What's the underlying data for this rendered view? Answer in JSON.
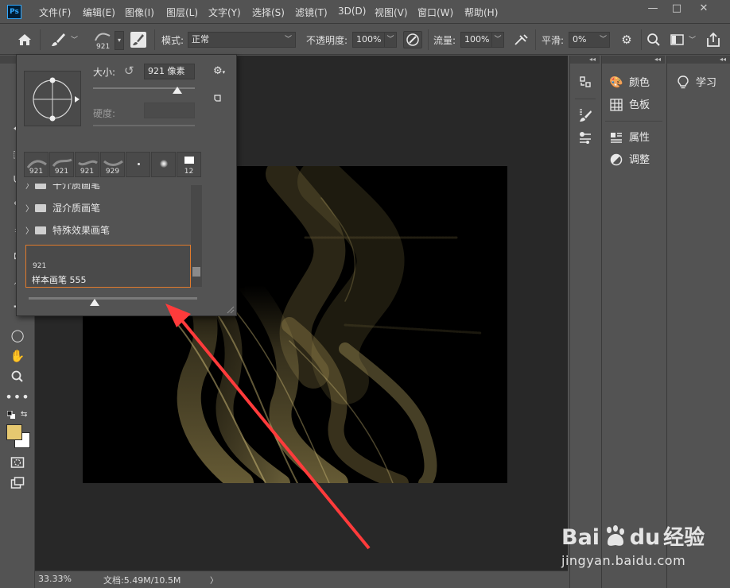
{
  "app": {
    "logo": "Ps",
    "menu": [
      "文件(F)",
      "编辑(E)",
      "图像(I)",
      "图层(L)",
      "文字(Y)",
      "选择(S)",
      "滤镜(T)",
      "3D(D)",
      "视图(V)",
      "窗口(W)",
      "帮助(H)"
    ],
    "window_controls": [
      "—",
      "□",
      "✕"
    ]
  },
  "options": {
    "brush_size": "921",
    "mode_label": "模式:",
    "mode_value": "正常",
    "opacity_label": "不透明度:",
    "opacity_value": "100%",
    "flow_label": "流量:",
    "flow_value": "100%",
    "smooth_label": "平滑:",
    "smooth_value": "0%"
  },
  "brush_panel": {
    "size_label": "大小:",
    "size_value": "921 像素",
    "size_slider_fraction": 0.83,
    "hardness_label": "硬度:",
    "hardness_value": "",
    "presets": [
      {
        "size": "921",
        "kind": "texture"
      },
      {
        "size": "921",
        "kind": "texture"
      },
      {
        "size": "921",
        "kind": "texture"
      },
      {
        "size": "929",
        "kind": "texture"
      },
      {
        "size": "",
        "kind": "small-dot"
      },
      {
        "size": "",
        "kind": "soft-dot"
      },
      {
        "size": "12",
        "kind": "square"
      }
    ],
    "folders": [
      "干介质画笔",
      "湿介质画笔",
      "特殊效果画笔"
    ],
    "selected_brush": {
      "size": "921",
      "name": "样本画笔 555"
    },
    "preview_slider_fraction": 0.39
  },
  "status": {
    "zoom": "33.33%",
    "doc_info": "文档:5.49M/10.5M",
    "arrow": "〉"
  },
  "panels": {
    "color_label": "颜色",
    "swatches_label": "色板",
    "properties_label": "属性",
    "adjustments_label": "调整",
    "learn_label": "学习",
    "collapse": "◂◂"
  },
  "colors": {
    "foreground": "#e6c870",
    "background": "#ffffff",
    "accent_selection": "#e07a2c",
    "annotation_arrow": "#ff3b3b"
  },
  "watermark": {
    "brand_a": "Bai",
    "brand_b": "du",
    "brand_c": "经验",
    "url": "jingyan.baidu.com"
  }
}
